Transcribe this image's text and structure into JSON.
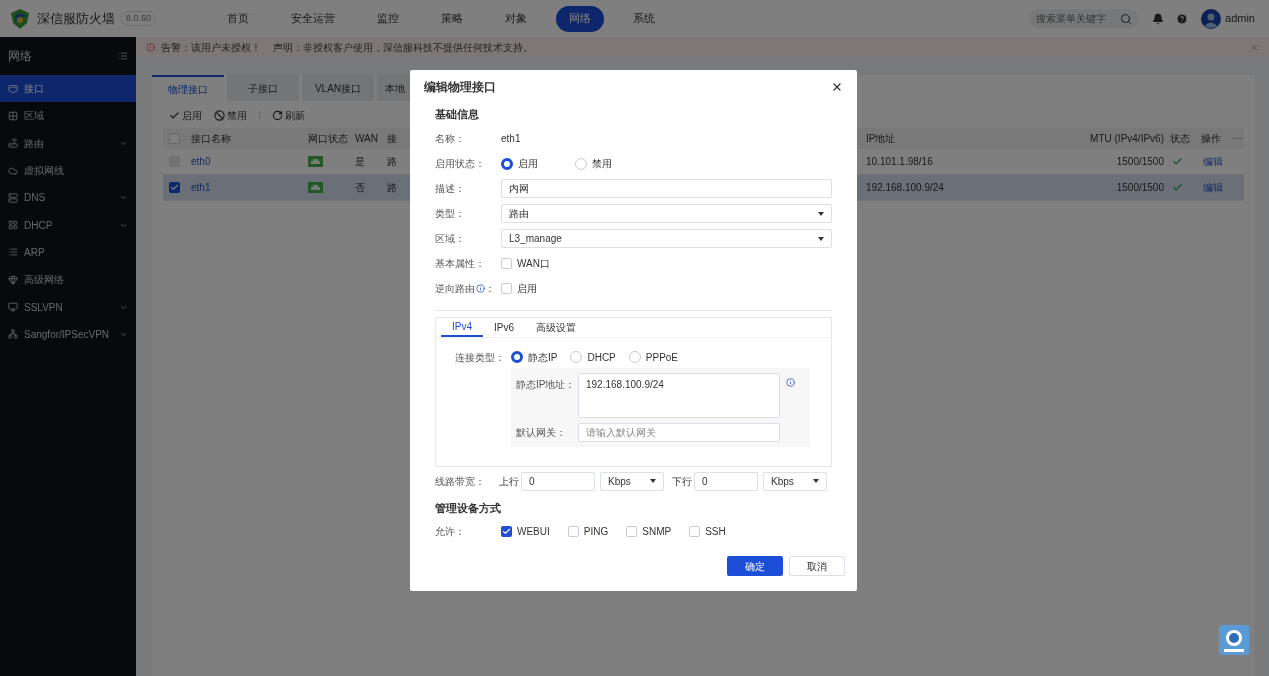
{
  "header": {
    "product": "深信服防火墙",
    "version": "8.0.60",
    "nav": [
      {
        "label": "首页",
        "selected": false
      },
      {
        "label": "安全运营",
        "selected": false
      },
      {
        "label": "监控",
        "selected": false
      },
      {
        "label": "策略",
        "selected": false
      },
      {
        "label": "对象",
        "selected": false
      },
      {
        "label": "网络",
        "selected": true
      },
      {
        "label": "系统",
        "selected": false
      }
    ],
    "search": {
      "placeholder": "搜索菜单关键字"
    },
    "user": "admin"
  },
  "alert": {
    "warning": "告警：该用户未授权！",
    "notice": "声明：非授权客户使用，深信服科技不提供任何技术支持。"
  },
  "sidebar": {
    "title": "网络",
    "items": [
      {
        "label": "接口",
        "selected": true,
        "expandable": false
      },
      {
        "label": "区域",
        "selected": false,
        "expandable": false
      },
      {
        "label": "路由",
        "selected": false,
        "expandable": true
      },
      {
        "label": "虚拟网线",
        "selected": false,
        "expandable": false
      },
      {
        "label": "DNS",
        "selected": false,
        "expandable": true
      },
      {
        "label": "DHCP",
        "selected": false,
        "expandable": true
      },
      {
        "label": "ARP",
        "selected": false,
        "expandable": false
      },
      {
        "label": "高级网络",
        "selected": false,
        "expandable": false
      },
      {
        "label": "SSLVPN",
        "selected": false,
        "expandable": true
      },
      {
        "label": "Sangfor/IPSecVPN",
        "selected": false,
        "expandable": true
      }
    ]
  },
  "tabs": [
    {
      "label": "物理接口",
      "selected": true
    },
    {
      "label": "子接口",
      "selected": false
    },
    {
      "label": "VLAN接口",
      "selected": false
    },
    {
      "label": "本地",
      "selected": false
    }
  ],
  "toolbar": [
    {
      "kind": "enable",
      "label": "启用"
    },
    {
      "kind": "disable",
      "label": "禁用"
    },
    {
      "kind": "refresh",
      "label": "刷新"
    }
  ],
  "table": {
    "select_all": {
      "checked": false
    },
    "columns": [
      "接口名称",
      "网口状态",
      "WAN",
      "接",
      "IP地址",
      "MTU (IPv4/IPv6)",
      "状态",
      "操作"
    ],
    "more": "⋯",
    "rows": [
      {
        "checked": false,
        "disabled": true,
        "selected": false,
        "name": "eth0",
        "wan": "是",
        "column_5": "路",
        "ip": "10.101.1.98/16",
        "mtu": "1500/1500",
        "action": "编辑"
      },
      {
        "checked": true,
        "disabled": false,
        "selected": true,
        "name": "eth1",
        "wan": "否",
        "column_5": "路",
        "ip": "192.168.100.9/24",
        "mtu": "1500/1500",
        "action": "编辑"
      }
    ]
  },
  "dialog": {
    "title": "编辑物理接口",
    "section_basic": "基础信息",
    "name": {
      "label": "名称：",
      "value": "eth1"
    },
    "enable_state": {
      "label": "启用状态：",
      "options": [
        {
          "label": "启用",
          "selected": true
        },
        {
          "label": "禁用",
          "selected": false
        }
      ]
    },
    "description": {
      "label": "描述：",
      "value": "内网"
    },
    "type": {
      "label": "类型：",
      "value": "路由"
    },
    "zone": {
      "label": "区域：",
      "value": "L3_manage"
    },
    "basic_attr": {
      "label": "基本属性：",
      "option": "WAN口",
      "checked": false
    },
    "reverse_route": {
      "label": "逆向路由",
      "label_suffix": "：",
      "option": "启用",
      "checked": false
    },
    "ip_tabs": [
      {
        "label": "IPv4",
        "selected": true
      },
      {
        "label": "IPv6",
        "selected": false
      },
      {
        "label": "高级设置",
        "selected": false
      }
    ],
    "connection_type": {
      "label": "连接类型：",
      "options": [
        {
          "label": "静态IP",
          "selected": true
        },
        {
          "label": "DHCP",
          "selected": false
        },
        {
          "label": "PPPoE",
          "selected": false
        }
      ]
    },
    "static_ip": {
      "label": "静态IP地址：",
      "value": "192.168.100.9/24"
    },
    "gateway": {
      "label": "默认网关：",
      "placeholder": "请输入默认网关"
    },
    "bandwidth": {
      "label": "线路带宽：",
      "up_label": "上行",
      "up_value": "0",
      "up_unit": "Kbps",
      "down_label": "下行",
      "down_value": "0",
      "down_unit": "Kbps"
    },
    "section_manage": "管理设备方式",
    "allow": {
      "label": "允许：",
      "options": [
        {
          "label": "WEBUI",
          "checked": true
        },
        {
          "label": "PING",
          "checked": false
        },
        {
          "label": "SNMP",
          "checked": false
        },
        {
          "label": "SSH",
          "checked": false
        }
      ]
    },
    "buttons": [
      {
        "kind": "primary",
        "label": "确定"
      },
      {
        "kind": "secondary",
        "label": "取消"
      }
    ]
  }
}
